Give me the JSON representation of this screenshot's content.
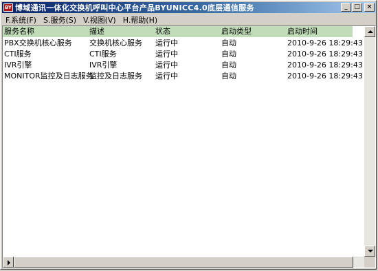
{
  "window": {
    "title": "博域通讯一体化交换机呼叫中心平台产品BYUNICC4.0底层通信服务",
    "icon_label": "BY",
    "controls": {
      "minimize": "_",
      "maximize": "□",
      "close": "×"
    }
  },
  "menu": [
    {
      "label": "F.系统(F)"
    },
    {
      "label": "S.服务(S)"
    },
    {
      "label": "V.视图(V)"
    },
    {
      "label": "H.帮助(H)"
    }
  ],
  "table": {
    "header_color": "#c1dcb8",
    "columns": [
      "服务名称",
      "描述",
      "状态",
      "启动类型",
      "启动时间"
    ],
    "rows": [
      [
        "PBX交换机核心服务",
        "交换机核心服务",
        "运行中",
        "自动",
        "2010-9-26 18:29:43"
      ],
      [
        "CTI服务",
        "CTI服务",
        "运行中",
        "自动",
        "2010-9-26 18:29:43"
      ],
      [
        "IVR引擎",
        "IVR引擎",
        "运行中",
        "自动",
        "2010-9-26 18:29:43"
      ],
      [
        "MONITOR监控及日志服务",
        "监控及日志服务",
        "运行中",
        "自动",
        "2010-9-26 18:29:43"
      ]
    ]
  }
}
